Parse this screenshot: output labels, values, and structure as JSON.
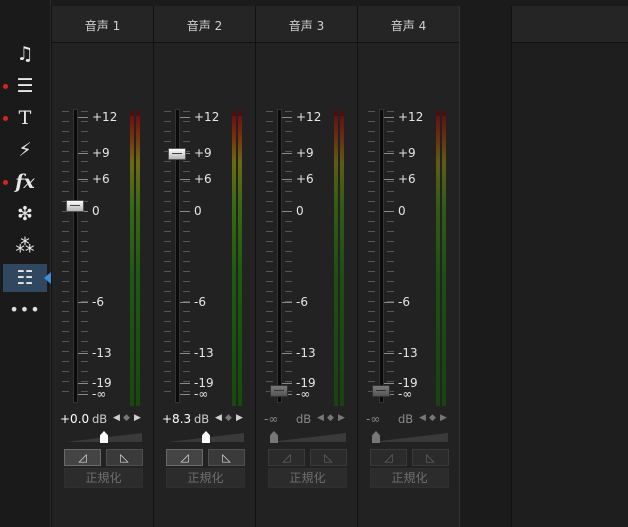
{
  "sidebar": {
    "items": [
      {
        "icon": "music-media-icon",
        "glyph": "♫",
        "marked": false,
        "active": false
      },
      {
        "icon": "clapperboard-icon",
        "glyph": "☰",
        "marked": true,
        "active": false
      },
      {
        "icon": "text-title-icon",
        "glyph": "T",
        "marked": true,
        "active": false
      },
      {
        "icon": "transition-icon",
        "glyph": "⚡",
        "marked": false,
        "active": false
      },
      {
        "icon": "fx-effects-icon",
        "glyph": "fx",
        "marked": true,
        "active": false
      },
      {
        "icon": "particle-icon",
        "glyph": "❇",
        "marked": false,
        "active": false
      },
      {
        "icon": "spray-icon",
        "glyph": "⁂",
        "marked": false,
        "active": false
      },
      {
        "icon": "audio-mixer-icon",
        "glyph": "☷",
        "marked": false,
        "active": true
      }
    ],
    "more_label": "•••"
  },
  "scale_labels": [
    "+12",
    "+9",
    "+6",
    "0",
    "-6",
    "-13",
    "-19",
    "-∞"
  ],
  "db_unit": "dB",
  "normalize_label": "正規化",
  "channels": [
    {
      "name": "音声 1",
      "value": "+0.0",
      "enabled": true,
      "fader_db": 0,
      "pan": 0.5,
      "fade_in_pressed": true
    },
    {
      "name": "音声 2",
      "value": "+8.3",
      "enabled": true,
      "fader_db": 8.3,
      "pan": 0.5,
      "fade_in_pressed": true
    },
    {
      "name": "音声 3",
      "value": "-∞",
      "enabled": false,
      "fader_db": null,
      "pan": 0.0,
      "fade_in_pressed": false
    },
    {
      "name": "音声 4",
      "value": "-∞",
      "enabled": false,
      "fader_db": null,
      "pan": 0.0,
      "fade_in_pressed": false
    }
  ],
  "colors": {
    "accent": "#3a8fd8",
    "marker": "#e01f1f",
    "active_bg": "#2f4860"
  }
}
